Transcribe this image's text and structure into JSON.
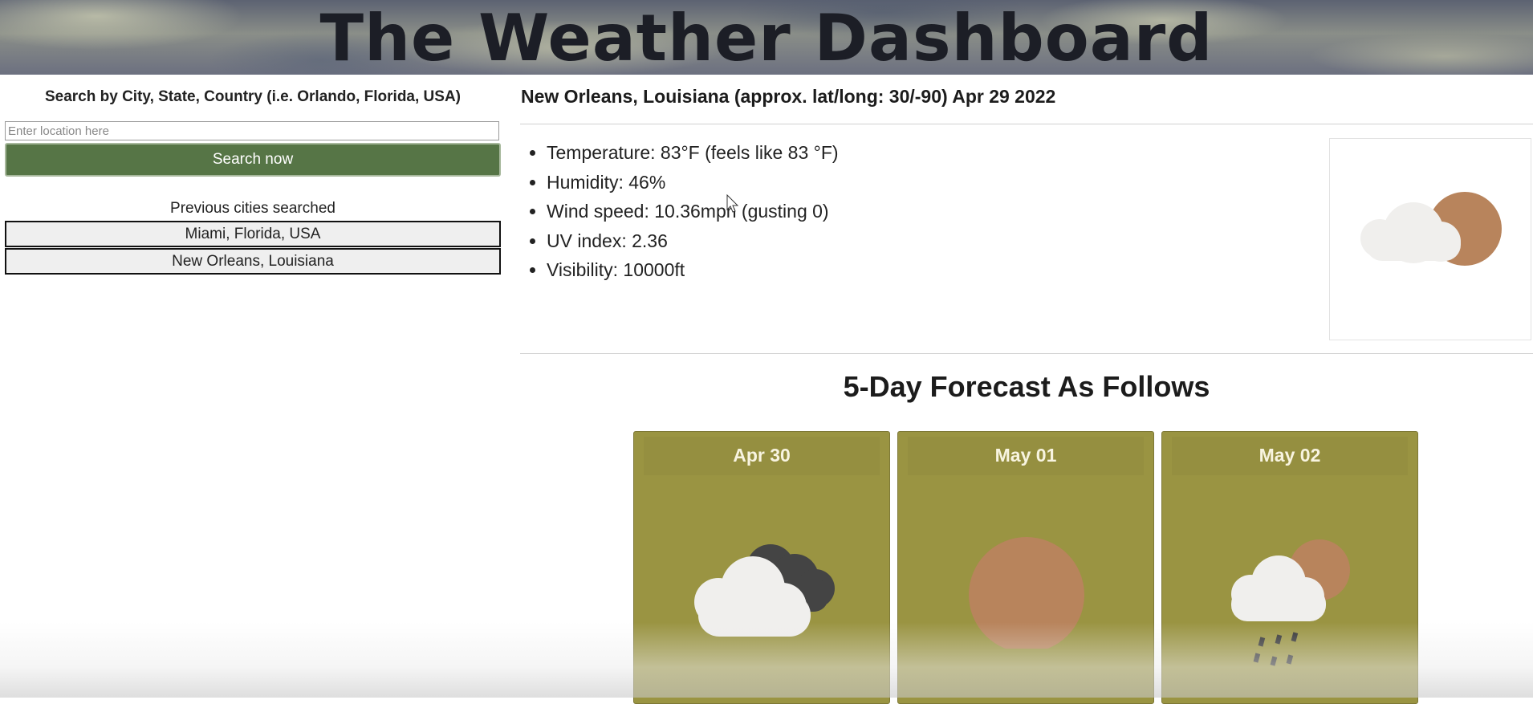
{
  "header": {
    "title": "The Weather Dashboard"
  },
  "search": {
    "label": "Search by City, State, Country (i.e. Orlando, Florida, USA)",
    "placeholder": "Enter location here",
    "value": "",
    "button_label": "Search now"
  },
  "history": {
    "label": "Previous cities searched",
    "items": [
      {
        "label": "Miami, Florida, USA"
      },
      {
        "label": "New Orleans, Louisiana"
      }
    ]
  },
  "current": {
    "heading": "New Orleans, Louisiana (approx. lat/long: 30/-90) Apr 29 2022",
    "stats": [
      "Temperature: 83°F (feels like 83 °F)",
      "Humidity: 46%",
      "Wind speed: 10.36mph (gusting 0)",
      "UV index: 2.36",
      "Visibility: 10000ft"
    ],
    "icon": "partly-cloudy-icon"
  },
  "forecast": {
    "title": "5-Day Forecast As Follows",
    "days": [
      {
        "date": "Apr 30",
        "icon": "cloudy-icon"
      },
      {
        "date": "May 01",
        "icon": "sunny-icon"
      },
      {
        "date": "May 02",
        "icon": "rain-icon"
      }
    ]
  },
  "colors": {
    "search_button": "#567546",
    "card_background": "#9a9442",
    "sun": "#b8845c",
    "cloud": "#f0efed",
    "dark_cloud": "#444444"
  }
}
